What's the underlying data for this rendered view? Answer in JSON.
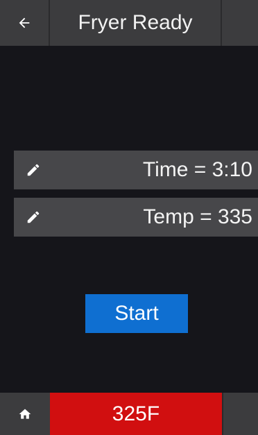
{
  "header": {
    "back_icon": "arrow-left-icon",
    "title": "Fryer Ready"
  },
  "settings": {
    "time_label": "Time = 3:10",
    "temp_label": "Temp = 335",
    "edit_icon": "pencil-icon"
  },
  "actions": {
    "start_label": "Start"
  },
  "footer": {
    "home_icon": "home-icon",
    "current_temp": "325F"
  },
  "colors": {
    "header_bg": "#3c3c3e",
    "background": "#15151a",
    "row_bg": "#47474a",
    "accent_blue": "#0f6fd1",
    "alert_red": "#d10f10"
  }
}
